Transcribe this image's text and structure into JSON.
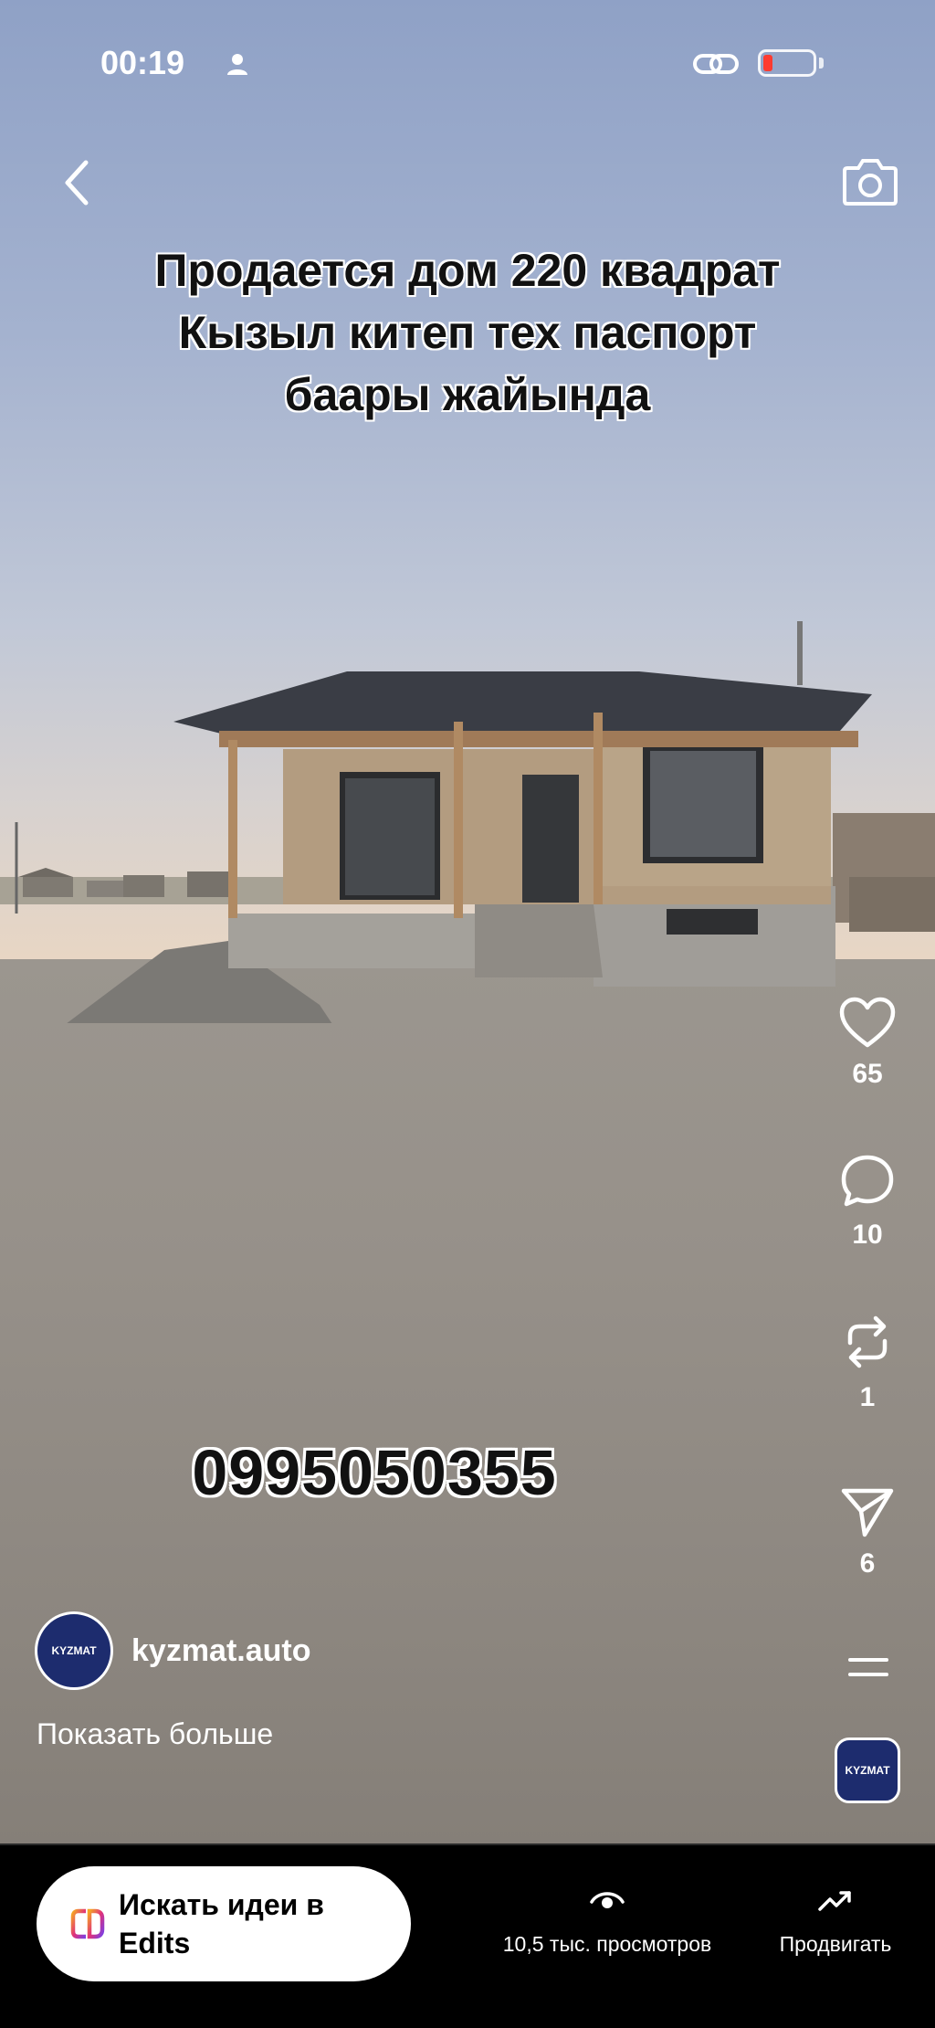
{
  "status_bar": {
    "time": "00:19"
  },
  "post": {
    "overlay_lines": [
      "Продается дом 220 квадрат",
      "Кызыл китеп тех паспорт",
      "баары жайында"
    ],
    "phone_overlay": "0995050355",
    "author": "kyzmat.auto",
    "avatar_text": "KYZMAT",
    "show_more": "Показать больше"
  },
  "actions": {
    "likes": "65",
    "comments": "10",
    "reposts": "1",
    "shares": "6"
  },
  "bottom_bar": {
    "edits_label_line1": "Искать идеи в",
    "edits_label_line2": "Edits",
    "views_label": "10,5 тыс. просмотров",
    "promote_label": "Продвигать"
  },
  "icons": [
    "person-icon",
    "link-icon",
    "battery-icon",
    "back-chevron-icon",
    "camera-icon",
    "heart-icon",
    "comment-icon",
    "repost-icon",
    "send-icon",
    "menu-icon",
    "eye-icon",
    "trend-icon",
    "edits-logo-icon"
  ],
  "colors": {
    "battery_low": "#ff3b30",
    "avatar_bg": "#1d2c6e"
  }
}
